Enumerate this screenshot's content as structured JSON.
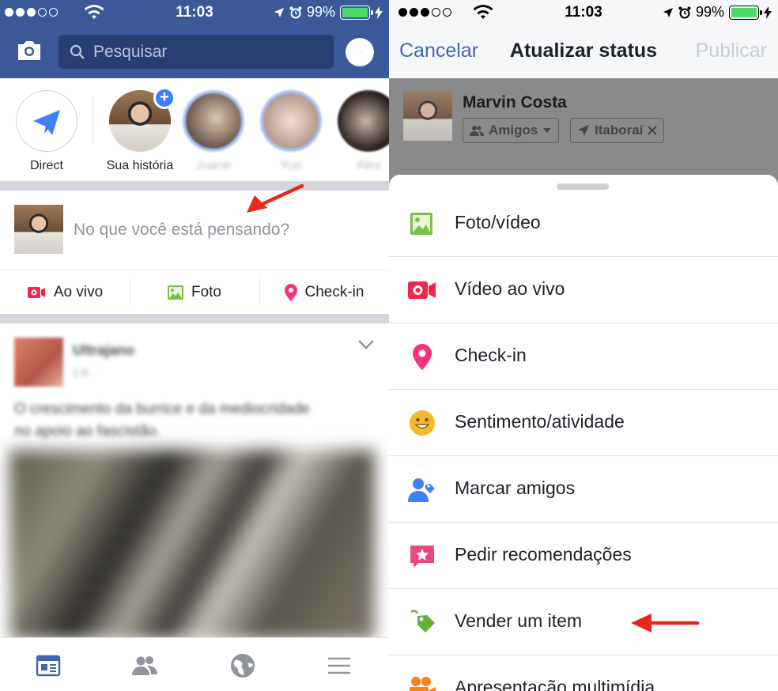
{
  "left": {
    "status": {
      "time": "11:03",
      "battery": "99%"
    },
    "search": {
      "placeholder": "Pesquisar"
    },
    "stories": [
      {
        "label": "Direct"
      },
      {
        "label": "Sua história"
      },
      {
        "label": "Joane"
      },
      {
        "label": "Yuri"
      },
      {
        "label": "Alex"
      }
    ],
    "composer": {
      "placeholder": "No que você está pensando?"
    },
    "actions": [
      {
        "label": "Ao vivo",
        "icon": "live-video-icon"
      },
      {
        "label": "Foto",
        "icon": "photo-icon"
      },
      {
        "label": "Check-in",
        "icon": "location-pin-icon"
      }
    ],
    "post": {
      "author": "Ultrajano",
      "meta": "1 h · ",
      "text": "O crescimento da burrice e da mediocridade no apoio ao fascistão."
    },
    "colors": {
      "brand": "#3b5998",
      "accent": "#4267b2",
      "arrow": "#e8281a"
    }
  },
  "right": {
    "status": {
      "time": "11:03",
      "battery": "99%"
    },
    "nav": {
      "cancel": "Cancelar",
      "title": "Atualizar status",
      "publish": "Publicar"
    },
    "user": {
      "name": "Marvin Costa",
      "audience": "Amigos",
      "location": "Itaboraí"
    },
    "options": [
      {
        "label": "Foto/vídeo",
        "icon": "photo-icon"
      },
      {
        "label": "Vídeo ao vivo",
        "icon": "live-video-icon"
      },
      {
        "label": "Check-in",
        "icon": "location-pin-icon"
      },
      {
        "label": "Sentimento/atividade",
        "icon": "smiley-icon"
      },
      {
        "label": "Marcar amigos",
        "icon": "tag-friends-icon"
      },
      {
        "label": "Pedir recomendações",
        "icon": "star-bubble-icon"
      },
      {
        "label": "Vender um item",
        "icon": "price-tag-icon"
      },
      {
        "label": "Apresentação multimídia",
        "icon": "film-camera-icon"
      }
    ]
  }
}
